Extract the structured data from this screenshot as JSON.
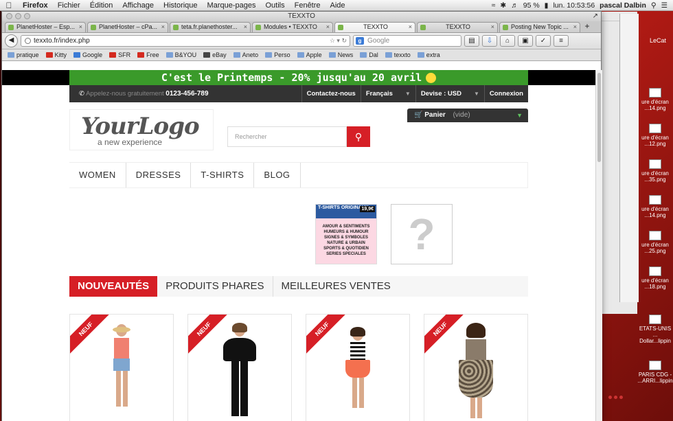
{
  "menubar": {
    "items": [
      "Firefox",
      "Fichier",
      "Édition",
      "Affichage",
      "Historique",
      "Marque-pages",
      "Outils",
      "Fenêtre",
      "Aide"
    ],
    "center_title": "TEXXTO",
    "battery": "95 %",
    "clock": "lun. 10:53:56",
    "user": "pascal Dalbin"
  },
  "browser": {
    "tabs": [
      {
        "label": "PlanetHoster – Esp...",
        "active": false
      },
      {
        "label": "PlanetHoster – cPa...",
        "active": false
      },
      {
        "label": "teta.fr.planethoster...",
        "active": false
      },
      {
        "label": "Modules • TEXXTO",
        "active": false
      },
      {
        "label": "TEXXTO",
        "active": true
      },
      {
        "label": "TEXXTO",
        "active": false
      },
      {
        "label": "Posting New Topic ...",
        "active": false
      }
    ],
    "url": "texxto.fr/index.php",
    "search_placeholder": "Google",
    "bookmarks": [
      "pratique",
      "Kitty",
      "Google",
      "SFR",
      "Free",
      "B&YOU",
      "eBay",
      "Aneto",
      "Perso",
      "Apple",
      "News",
      "Dal",
      "texxto",
      "extra"
    ]
  },
  "site": {
    "promo": "C'est le Printemps  - 20% jusqu'au 20 avril",
    "phone_label": "Appelez-nous gratuitement",
    "phone_number": "0123-456-789",
    "contact": "Contactez-nous",
    "language": "Français",
    "currency": "Devise : USD",
    "login": "Connexion",
    "logo_main": "YourLogo",
    "logo_sub": "a new experience",
    "search_placeholder": "Rechercher",
    "cart_label": "Panier",
    "cart_state": "(vide)",
    "nav": [
      "WOMEN",
      "DRESSES",
      "T-SHIRTS",
      "BLOG"
    ],
    "banner": {
      "title": "T-SHIRTS ORIGINAUX",
      "price": "19,9€",
      "lines": [
        "AMOUR & SENTIMENTS",
        "HUMEURS & HUMOUR",
        "SIGNES & SYMBOLES",
        "NATURE & URBAIN",
        "SPORTS & QUOTIDIEN",
        "SERIES SPECIALES"
      ]
    },
    "placeholder_glyph": "?",
    "product_tabs": [
      "NOUVEAUTÉS",
      "PRODUITS PHARES",
      "MEILLEURES VENTES"
    ],
    "new_badge": "NEUF"
  },
  "desktop": {
    "label": "LeCat",
    "files": [
      "ure d'écran ...14.png",
      "ure d'écran ...12.png",
      "ure d'écran ...35.png",
      "ure d'écran ...14.png",
      "ure d'écran ...25.png",
      "ure d'écran ...18.png",
      "ETATS-UNIS ... Dollar...lippin",
      "PARIS CDG - ...ARRI...lippin"
    ]
  },
  "colors": {
    "accent_red": "#d61f26",
    "promo_green": "#3a9a2a",
    "dark_bar": "#333333"
  }
}
